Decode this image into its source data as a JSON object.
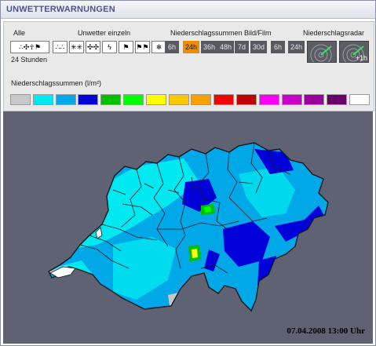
{
  "header": {
    "title": "UNWETTERWARNUNGEN"
  },
  "controls": {
    "all_label": "Alle",
    "all_button_glyph": "∴✣☥⚑",
    "single_label": "Unwetter einzeln",
    "single_buttons": [
      {
        "glyph": "∴∴",
        "icon": "rain-icon"
      },
      {
        "glyph": "✳✳",
        "icon": "snow-icon"
      },
      {
        "glyph": "✣✣",
        "icon": "hail-icon"
      },
      {
        "glyph": "ϟ",
        "icon": "lightning-icon"
      },
      {
        "glyph": "⚑",
        "icon": "wind-flag-icon"
      },
      {
        "glyph": "⚑⚑",
        "icon": "storm-flag-icon"
      },
      {
        "glyph": "❄",
        "icon": "frost-icon"
      }
    ],
    "time_label": "24 Stunden",
    "precip_label": "Niederschlagssummen Bild/Film",
    "precip_buttons": [
      "6h",
      "24h",
      "36h",
      "48h",
      "7d",
      "30d",
      "6h",
      "24h"
    ],
    "precip_active_index": 1,
    "radar_label": "Niederschlagsradar",
    "radar_buttons": [
      {
        "sub": ""
      },
      {
        "sub": "+1h"
      }
    ]
  },
  "legend": {
    "label": "Niederschlagssummen (l/m²)",
    "colors": [
      "#c8c8c8",
      "#00e8f0",
      "#00a8e8",
      "#0000d8",
      "#00c000",
      "#00ff00",
      "#ffff00",
      "#f8c800",
      "#f8a000",
      "#f80000",
      "#c00000",
      "#f800f8",
      "#c800c8",
      "#980098",
      "#680068",
      "#ffffff"
    ]
  },
  "map": {
    "datestamp": "07.04.2008 13:00 Uhr",
    "background": "#5e6272",
    "land_base": "#00a8e8",
    "land_light": "#00e8f0",
    "land_dark": "#0000d8",
    "border_color": "#101820"
  }
}
